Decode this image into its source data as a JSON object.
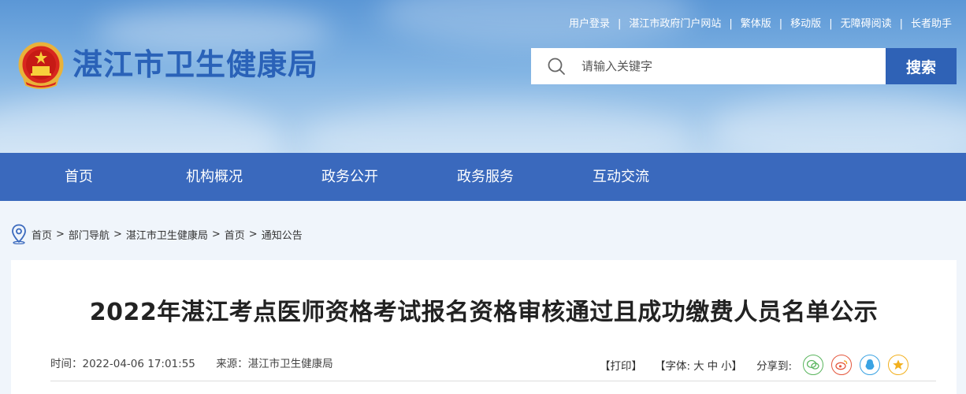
{
  "header": {
    "site_title": "湛江市卫生健康局",
    "emblem_icon": "national-emblem-icon",
    "top_links": [
      "用户登录",
      "湛江市政府门户网站",
      "繁体版",
      "移动版",
      "无障碍阅读",
      "长者助手"
    ],
    "search": {
      "placeholder": "请输入关键字",
      "button_label": "搜索"
    }
  },
  "nav": {
    "items": [
      "首页",
      "机构概况",
      "政务公开",
      "政务服务",
      "互动交流"
    ]
  },
  "breadcrumb": {
    "icon": "location-pin-icon",
    "items": [
      "首页",
      "部门导航",
      "湛江市卫生健康局",
      "首页",
      "通知公告"
    ],
    "separator": ">"
  },
  "article": {
    "title": "2022年湛江考点医师资格考试报名资格审核通过且成功缴费人员名单公示",
    "time": "时间：2022-04-06 17:01:55",
    "source": "来源：湛江市卫生健康局",
    "print_label": "【打印】",
    "font_label": "【字体:",
    "font_large": "大",
    "font_medium": "中",
    "font_small": "小】",
    "share_label": "分享到:",
    "share_icons": [
      "wechat-icon",
      "weibo-icon",
      "qq-icon",
      "qzone-icon"
    ]
  },
  "colors": {
    "nav_bg": "#3a69bd",
    "search_btn": "#2f62b6",
    "title_blue": "#2a62b8"
  }
}
